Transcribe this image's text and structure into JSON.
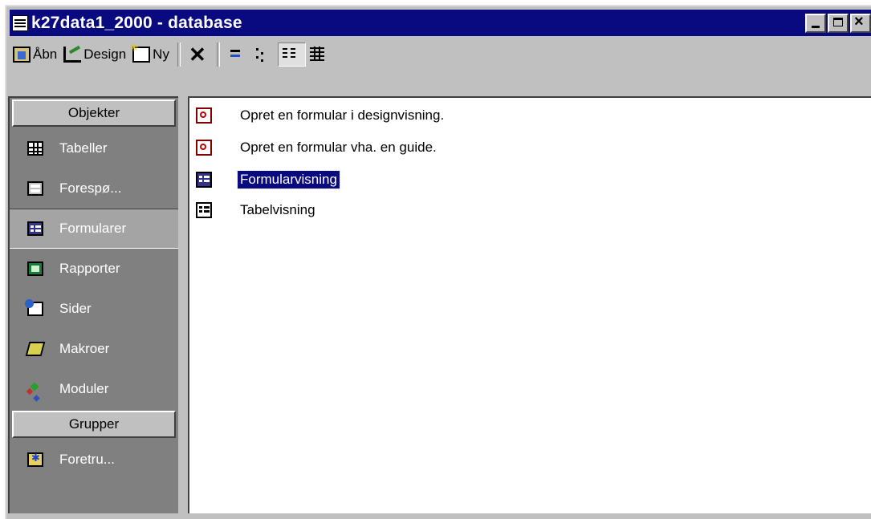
{
  "window": {
    "title": "k27data1_2000 - database",
    "title_icon": "database-window-icon",
    "controls": [
      "minimize",
      "maximize",
      "close"
    ]
  },
  "toolbar": {
    "open_label": "Åbn",
    "design_label": "Design",
    "new_label": "Ny",
    "view_buttons": [
      "large-icons",
      "small-icons",
      "list",
      "details"
    ],
    "active_view": "list"
  },
  "sidebar": {
    "objects_header": "Objekter",
    "items": [
      {
        "label": "Tabeller",
        "icon": "table-icon"
      },
      {
        "label": "Forespø...",
        "icon": "query-icon"
      },
      {
        "label": "Formularer",
        "icon": "form-icon",
        "active": true
      },
      {
        "label": "Rapporter",
        "icon": "report-icon"
      },
      {
        "label": "Sider",
        "icon": "page-icon"
      },
      {
        "label": "Makroer",
        "icon": "macro-icon"
      },
      {
        "label": "Moduler",
        "icon": "module-icon"
      }
    ],
    "groups_header": "Grupper",
    "group_items": [
      {
        "label": "Foretru...",
        "icon": "favorites-folder-icon"
      }
    ]
  },
  "list": {
    "items": [
      {
        "label": "Opret en formular i designvisning.",
        "icon": "create-form-design-icon"
      },
      {
        "label": "Opret en formular vha. en guide.",
        "icon": "create-form-wizard-icon"
      },
      {
        "label": "Formularvisning",
        "icon": "form-icon",
        "selected": true
      },
      {
        "label": "Tabelvisning",
        "icon": "form-icon"
      }
    ]
  },
  "colors": {
    "titlebar": "#0a0a80",
    "sidebar_bg": "#808080",
    "face": "#c0c0c0",
    "selection": "#0a0a80"
  }
}
